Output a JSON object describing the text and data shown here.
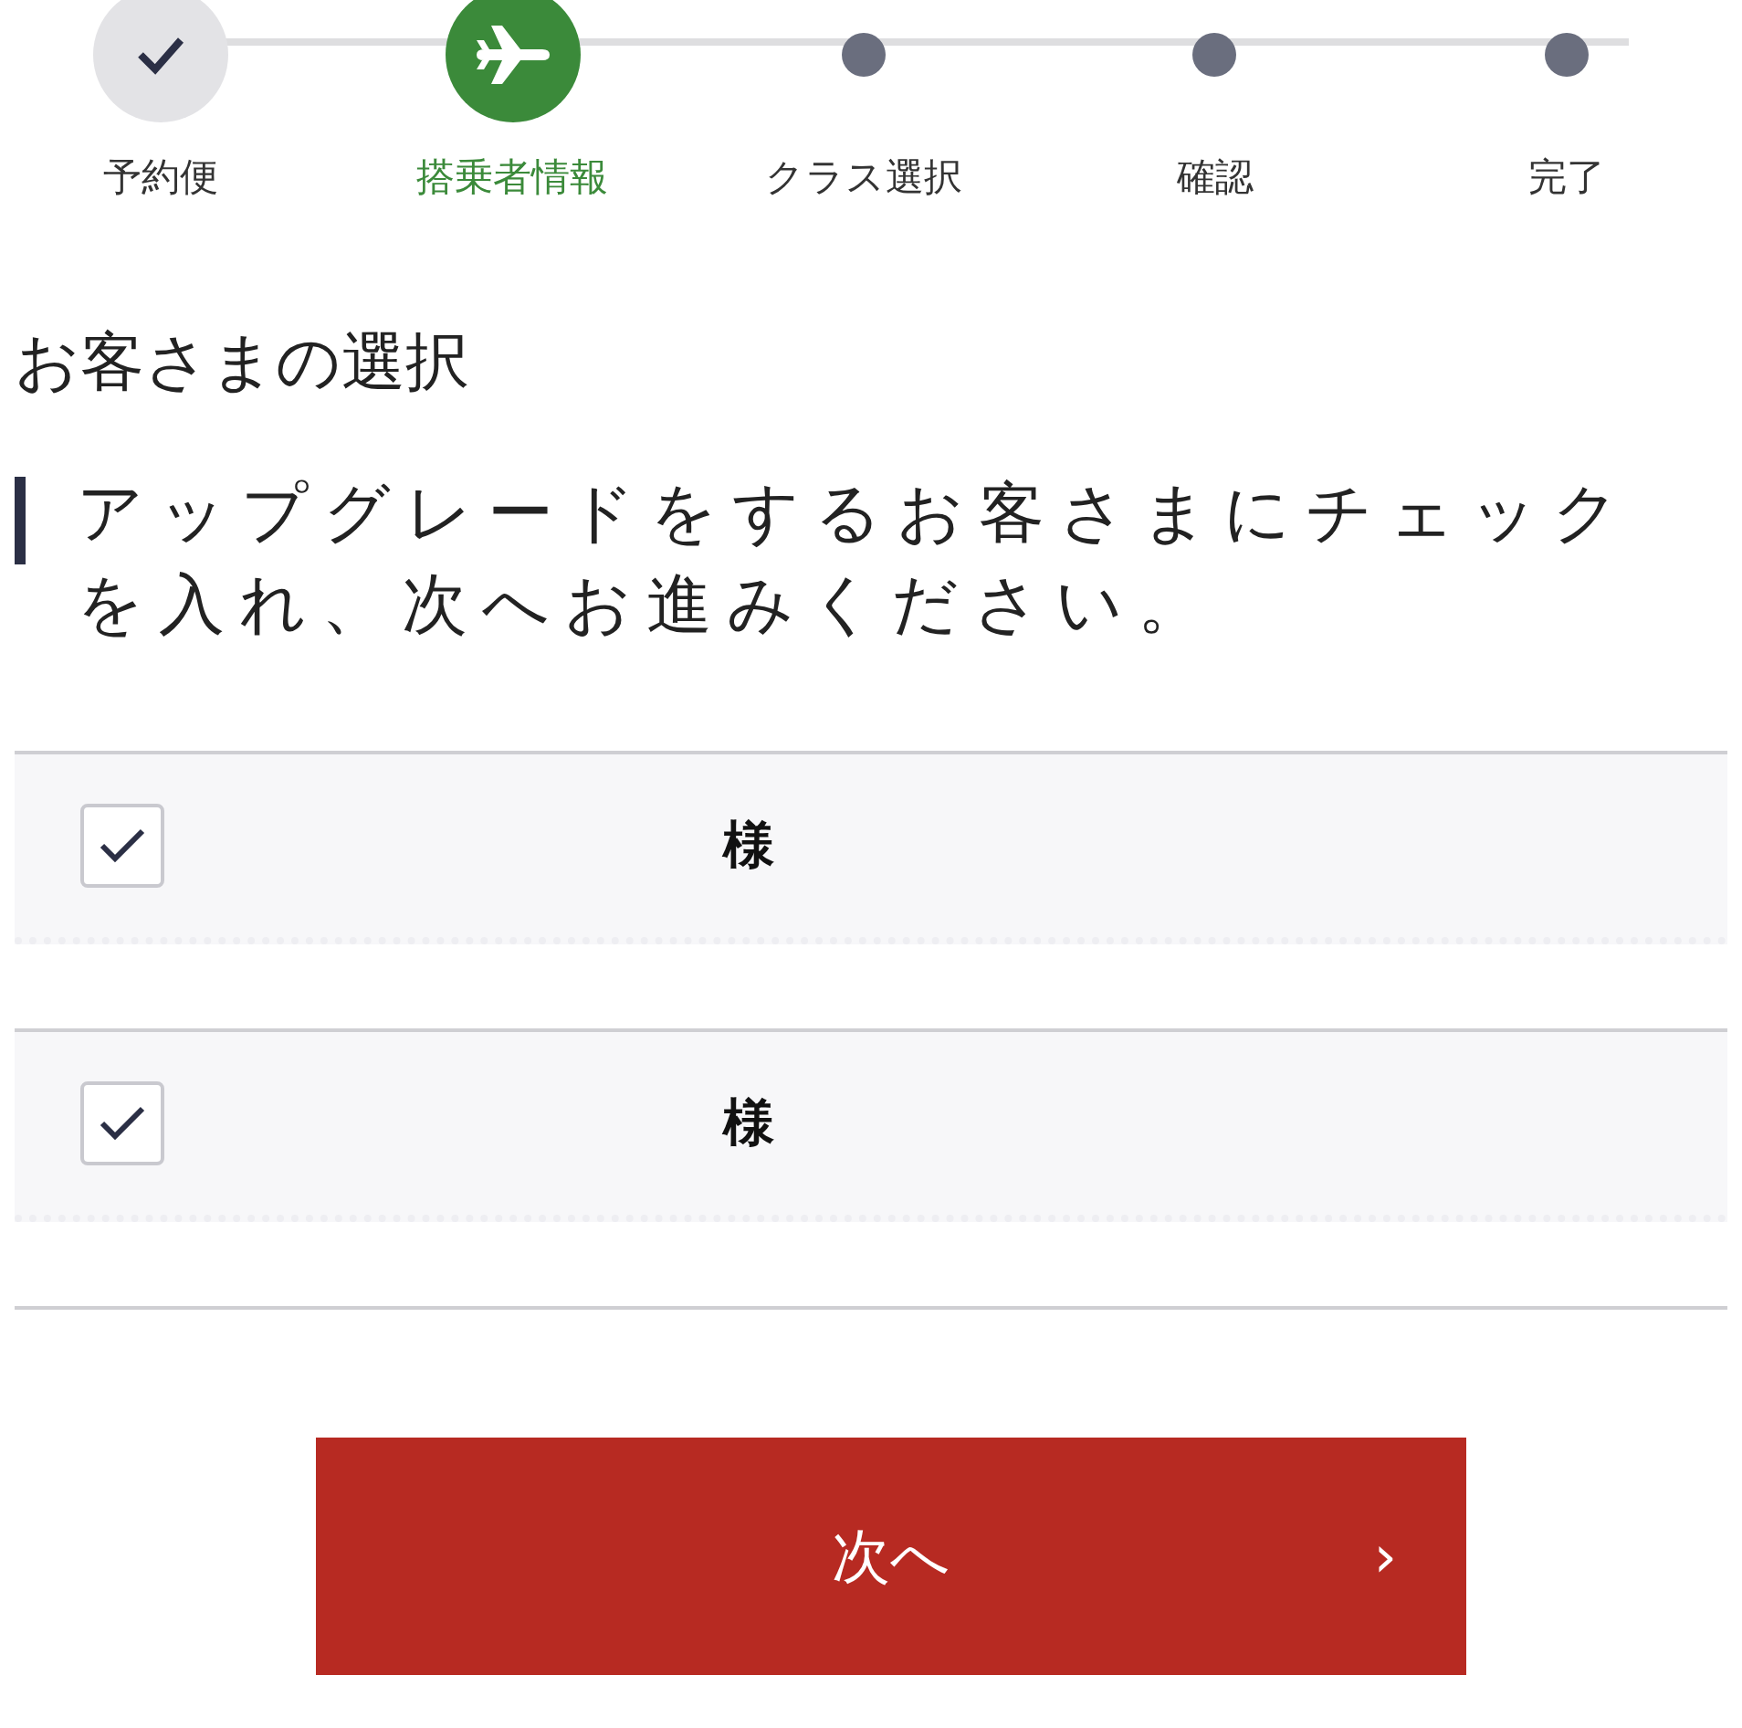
{
  "steps": [
    {
      "label": "予約便",
      "kind": "done"
    },
    {
      "label": "搭乗者情報",
      "kind": "current"
    },
    {
      "label": "クラス選択",
      "kind": "pending"
    },
    {
      "label": "確認",
      "kind": "pending"
    },
    {
      "label": "完了",
      "kind": "pending"
    }
  ],
  "title": "お客さまの選択",
  "instruction": "アップグレードをするお客さまにチェックを入れ、次へお進みください。",
  "passengers": [
    {
      "name": "様",
      "checked": true
    },
    {
      "name": "様",
      "checked": true
    }
  ],
  "next_button": {
    "label": "次へ",
    "arrow": "›"
  }
}
